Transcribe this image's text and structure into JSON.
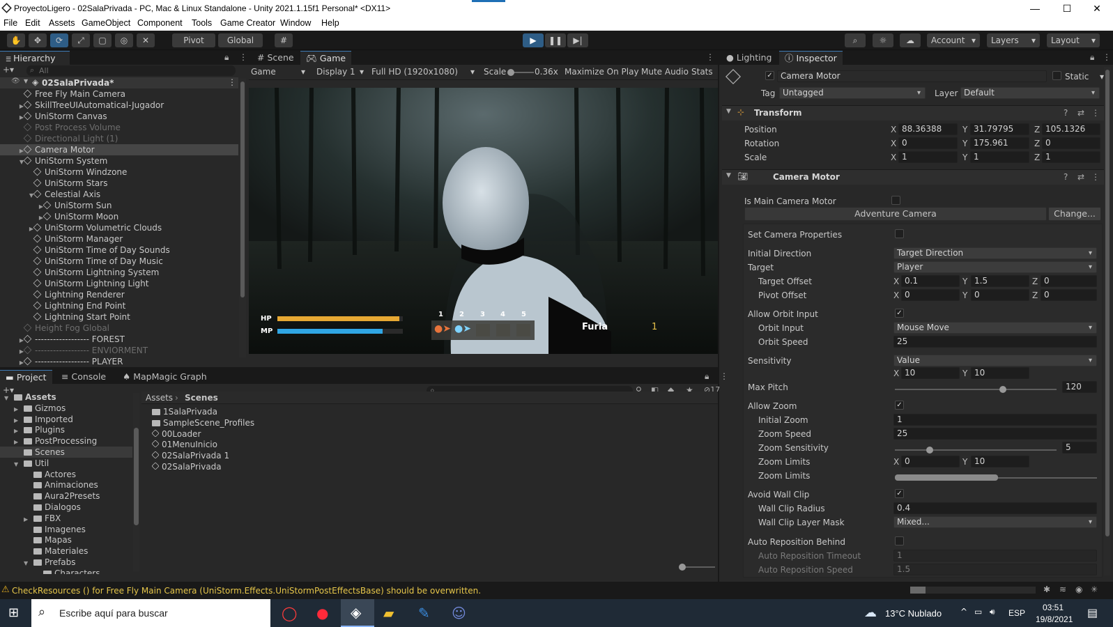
{
  "window": {
    "title": "ProyectoLigero - 02SalaPrivada - PC, Mac & Linux Standalone - Unity 2021.1.15f1 Personal* <DX11>",
    "minimize": "—",
    "maximize": "☐",
    "close": "✕"
  },
  "menu": [
    "File",
    "Edit",
    "Assets",
    "GameObject",
    "Component",
    "Tools",
    "Game Creator",
    "Window",
    "Help"
  ],
  "toolbar": {
    "pivot": "Pivot",
    "global": "Global",
    "account": "Account",
    "layers": "Layers",
    "layout": "Layout"
  },
  "hierarchy": {
    "tab": "Hierarchy",
    "search_placeholder": "All",
    "scene": "02SalaPrivada*",
    "items": [
      {
        "label": "Free Fly Main Camera",
        "indent": 1,
        "arrow": "",
        "state": "normal"
      },
      {
        "label": "SkillTreeUIAutomatical-Jugador",
        "indent": 1,
        "arrow": "▶",
        "state": "normal"
      },
      {
        "label": "UniStorm Canvas",
        "indent": 1,
        "arrow": "▶",
        "state": "normal"
      },
      {
        "label": "Post Process Volume",
        "indent": 1,
        "arrow": "",
        "state": "dim"
      },
      {
        "label": "Directional Light (1)",
        "indent": 1,
        "arrow": "",
        "state": "dim"
      },
      {
        "label": "Camera Motor",
        "indent": 1,
        "arrow": "▶",
        "state": "selected"
      },
      {
        "label": "UniStorm System",
        "indent": 1,
        "arrow": "▼",
        "state": "normal"
      },
      {
        "label": "UniStorm Windzone",
        "indent": 2,
        "arrow": "",
        "state": "normal"
      },
      {
        "label": "UniStorm Stars",
        "indent": 2,
        "arrow": "",
        "state": "normal"
      },
      {
        "label": "Celestial Axis",
        "indent": 2,
        "arrow": "▼",
        "state": "normal"
      },
      {
        "label": "UniStorm Sun",
        "indent": 3,
        "arrow": "▶",
        "state": "normal"
      },
      {
        "label": "UniStorm Moon",
        "indent": 3,
        "arrow": "▶",
        "state": "normal"
      },
      {
        "label": "UniStorm Volumetric Clouds",
        "indent": 2,
        "arrow": "▶",
        "state": "normal"
      },
      {
        "label": "UniStorm Manager",
        "indent": 2,
        "arrow": "",
        "state": "normal"
      },
      {
        "label": "UniStorm Time of Day Sounds",
        "indent": 2,
        "arrow": "",
        "state": "normal"
      },
      {
        "label": "UniStorm Time of Day Music",
        "indent": 2,
        "arrow": "",
        "state": "normal"
      },
      {
        "label": "UniStorm Lightning System",
        "indent": 2,
        "arrow": "",
        "state": "normal"
      },
      {
        "label": "UniStorm Lightning Light",
        "indent": 2,
        "arrow": "",
        "state": "normal"
      },
      {
        "label": "Lightning Renderer",
        "indent": 2,
        "arrow": "",
        "state": "normal"
      },
      {
        "label": "Lightning End Point",
        "indent": 2,
        "arrow": "",
        "state": "normal"
      },
      {
        "label": "Lightning Start Point",
        "indent": 2,
        "arrow": "",
        "state": "normal"
      },
      {
        "label": "Height Fog Global",
        "indent": 1,
        "arrow": "",
        "state": "dim"
      },
      {
        "label": "------------------ FOREST",
        "indent": 1,
        "arrow": "▶",
        "state": "normal"
      },
      {
        "label": "------------------ ENVIORMENT",
        "indent": 1,
        "arrow": "▶",
        "state": "dim"
      },
      {
        "label": "------------------ PLAYER",
        "indent": 1,
        "arrow": "▶",
        "state": "normal"
      }
    ]
  },
  "game_view": {
    "tab_scene": "Scene",
    "tab_game": "Game",
    "view_mode": "Game",
    "display": "Display 1",
    "resolution": "Full HD (1920x1080)",
    "scale_label": "Scale",
    "scale_value": "0.36x",
    "maximize": "Maximize On Play",
    "mute": "Mute Audio",
    "stats": "Stats",
    "hud": {
      "hp_label": "HP",
      "mp_label": "MP",
      "hp_fraction": 0.97,
      "mp_fraction": 0.84,
      "slots": [
        "1",
        "2",
        "3",
        "4",
        "5"
      ],
      "target_name": "Furia",
      "target_level": "1"
    }
  },
  "inspector": {
    "tab_lighting": "Lighting",
    "tab_inspector": "Inspector",
    "object_name": "Camera Motor",
    "static": "Static",
    "tag_label": "Tag",
    "tag_value": "Untagged",
    "layer_label": "Layer",
    "layer_value": "Default",
    "transform": {
      "title": "Transform",
      "position_label": "Position",
      "position": [
        "88.36388",
        "31.79795",
        "105.1326"
      ],
      "rotation_label": "Rotation",
      "rotation": [
        "0",
        "175.961",
        "0"
      ],
      "scale_label": "Scale",
      "scale": [
        "1",
        "1",
        "1"
      ]
    },
    "camera_motor": {
      "title": "Camera Motor",
      "is_main": "Is Main Camera Motor",
      "adventure": "Adventure Camera",
      "change": "Change...",
      "set_props": "Set Camera Properties",
      "initial_direction_label": "Initial Direction",
      "initial_direction": "Target Direction",
      "target_label": "Target",
      "target": "Player",
      "target_offset_label": "Target Offset",
      "target_offset": [
        "0.1",
        "1.5",
        "0"
      ],
      "pivot_offset_label": "Pivot Offset",
      "pivot_offset": [
        "0",
        "0",
        "0"
      ],
      "allow_orbit": "Allow Orbit Input",
      "orbit_input_label": "Orbit Input",
      "orbit_input": "Mouse Move",
      "orbit_speed_label": "Orbit Speed",
      "orbit_speed": "25",
      "sensitivity_label": "Sensitivity",
      "sensitivity": "Value",
      "sensitivity_xy": [
        "10",
        "10"
      ],
      "max_pitch_label": "Max Pitch",
      "max_pitch": "120",
      "allow_zoom": "Allow Zoom",
      "initial_zoom_label": "Initial Zoom",
      "initial_zoom": "1",
      "zoom_speed_label": "Zoom Speed",
      "zoom_speed": "25",
      "zoom_sens_label": "Zoom Sensitivity",
      "zoom_sens": "5",
      "zoom_limits_label": "Zoom Limits",
      "zoom_limits": [
        "0",
        "10"
      ],
      "zoom_limits2_label": "Zoom Limits",
      "avoid_wall": "Avoid Wall Clip",
      "wall_radius_label": "Wall Clip Radius",
      "wall_radius": "0.4",
      "wall_mask_label": "Wall Clip Layer Mask",
      "wall_mask": "Mixed...",
      "auto_repos": "Auto Reposition Behind",
      "auto_timeout_label": "Auto Reposition Timeout",
      "auto_timeout": "1",
      "auto_speed_label": "Auto Reposition Speed",
      "auto_speed": "1.5"
    }
  },
  "project": {
    "tab_project": "Project",
    "tab_console": "Console",
    "tab_mapmagic": "MapMagic Graph",
    "hidden_count": "17",
    "breadcrumb": [
      "Assets",
      "Scenes"
    ],
    "tree": [
      {
        "label": "Assets",
        "indent": 0,
        "arrow": "▼",
        "bold": true
      },
      {
        "label": "Gizmos",
        "indent": 1,
        "arrow": "▶"
      },
      {
        "label": "Imported",
        "indent": 1,
        "arrow": "▶"
      },
      {
        "label": "Plugins",
        "indent": 1,
        "arrow": "▶"
      },
      {
        "label": "PostProcessing",
        "indent": 1,
        "arrow": "▶"
      },
      {
        "label": "Scenes",
        "indent": 1,
        "arrow": "",
        "selected": true
      },
      {
        "label": "Util",
        "indent": 1,
        "arrow": "▼"
      },
      {
        "label": "Actores",
        "indent": 2,
        "arrow": ""
      },
      {
        "label": "Animaciones",
        "indent": 2,
        "arrow": ""
      },
      {
        "label": "Aura2Presets",
        "indent": 2,
        "arrow": ""
      },
      {
        "label": "Dialogos",
        "indent": 2,
        "arrow": ""
      },
      {
        "label": "FBX",
        "indent": 2,
        "arrow": "▶"
      },
      {
        "label": "Imagenes",
        "indent": 2,
        "arrow": ""
      },
      {
        "label": "Mapas",
        "indent": 2,
        "arrow": ""
      },
      {
        "label": "Materiales",
        "indent": 2,
        "arrow": ""
      },
      {
        "label": "Prefabs",
        "indent": 2,
        "arrow": "▼"
      },
      {
        "label": "Characters",
        "indent": 3,
        "arrow": ""
      }
    ],
    "files": [
      {
        "label": "1SalaPrivada",
        "kind": "folder"
      },
      {
        "label": "SampleScene_Profiles",
        "kind": "folder"
      },
      {
        "label": "00Loader",
        "kind": "scene"
      },
      {
        "label": "01MenuInicio",
        "kind": "scene"
      },
      {
        "label": "02SalaPrivada 1",
        "kind": "scene"
      },
      {
        "label": "02SalaPrivada",
        "kind": "scene"
      }
    ]
  },
  "status": {
    "warning": "CheckResources () for Free Fly Main Camera (UniStorm.Effects.UniStormPostEffectsBase) should be overwritten."
  },
  "taskbar": {
    "search_placeholder": "Escribe aquí para buscar",
    "weather": "13°C  Nublado",
    "lang": "ESP",
    "time": "03:51",
    "date": "19/8/2021"
  }
}
